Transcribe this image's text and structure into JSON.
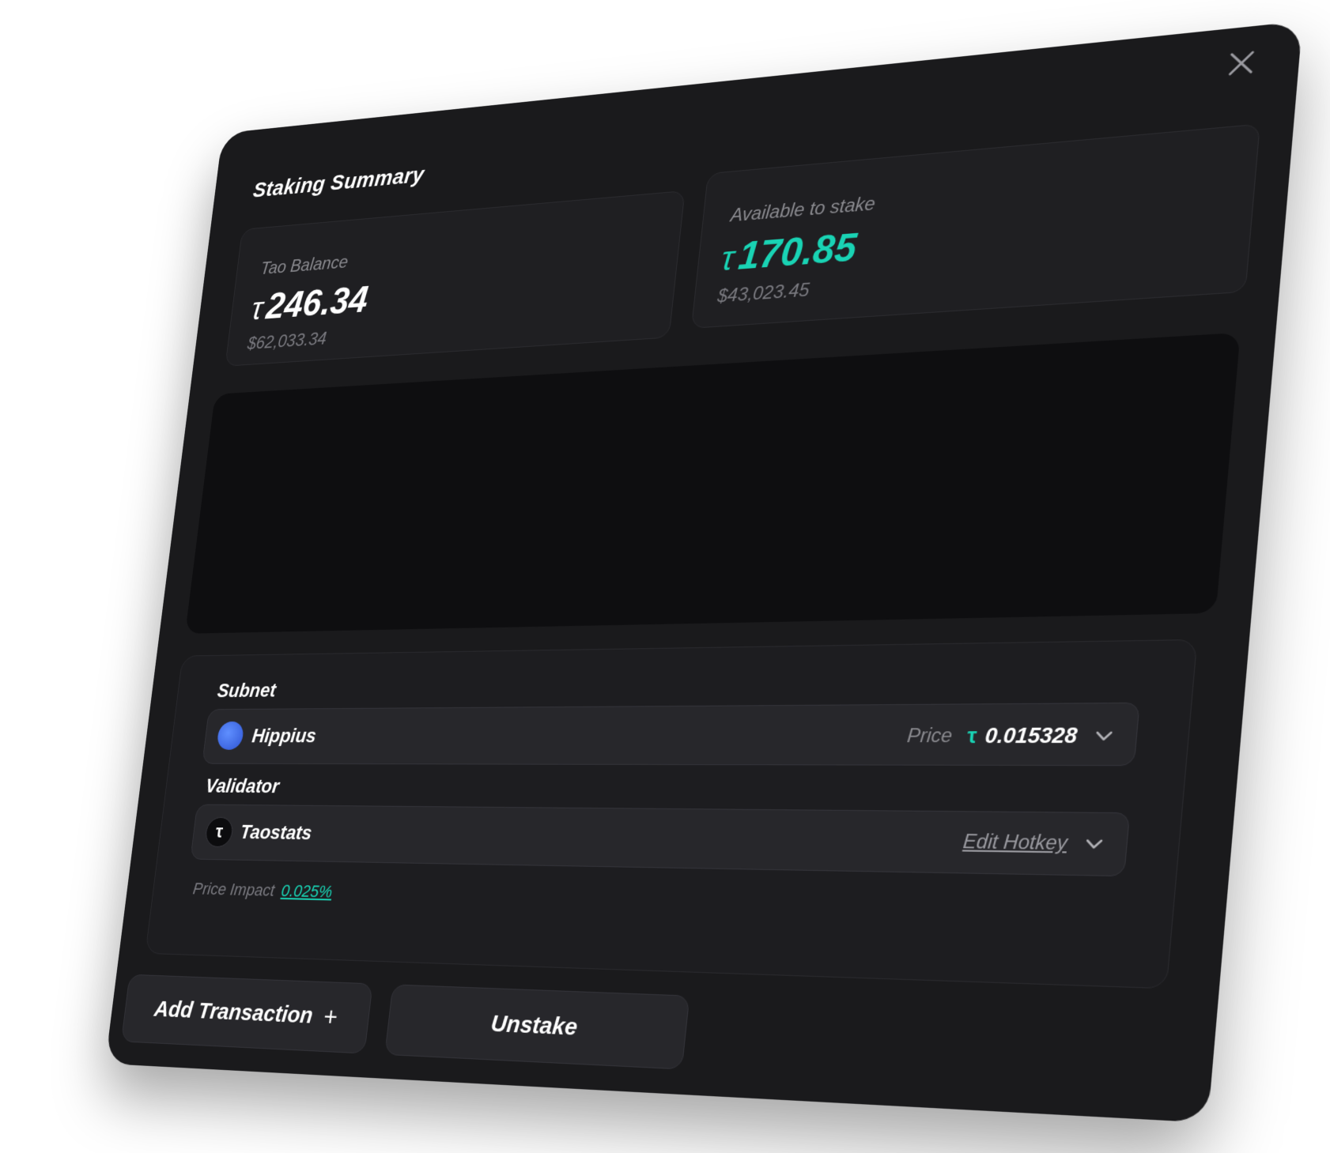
{
  "window": {
    "title": "Staking Summary",
    "close_icon": "close-icon"
  },
  "balance": {
    "label": "Tao Balance",
    "symbol": "τ",
    "value": "246.34",
    "usd": "$62,033.34"
  },
  "available": {
    "label": "Available to stake",
    "symbol": "τ",
    "value": "170.85",
    "usd": "$43,023.45"
  },
  "subnet": {
    "label": "Subnet",
    "name": "Hippius",
    "price_label": "Price",
    "price_symbol": "τ",
    "price_value": "0.015328"
  },
  "validator": {
    "label": "Validator",
    "icon_glyph": "τ",
    "name": "Taostats",
    "edit_hotkey": "Edit Hotkey"
  },
  "impact": {
    "label": "Price Impact",
    "value": "0.025%"
  },
  "buttons": {
    "add_transaction": "Add Transaction",
    "add_icon": "+",
    "unstake": "Unstake"
  },
  "colors": {
    "panel": "#1a1a1c",
    "accent": "#19d3b4",
    "card": "#1f1f22"
  }
}
